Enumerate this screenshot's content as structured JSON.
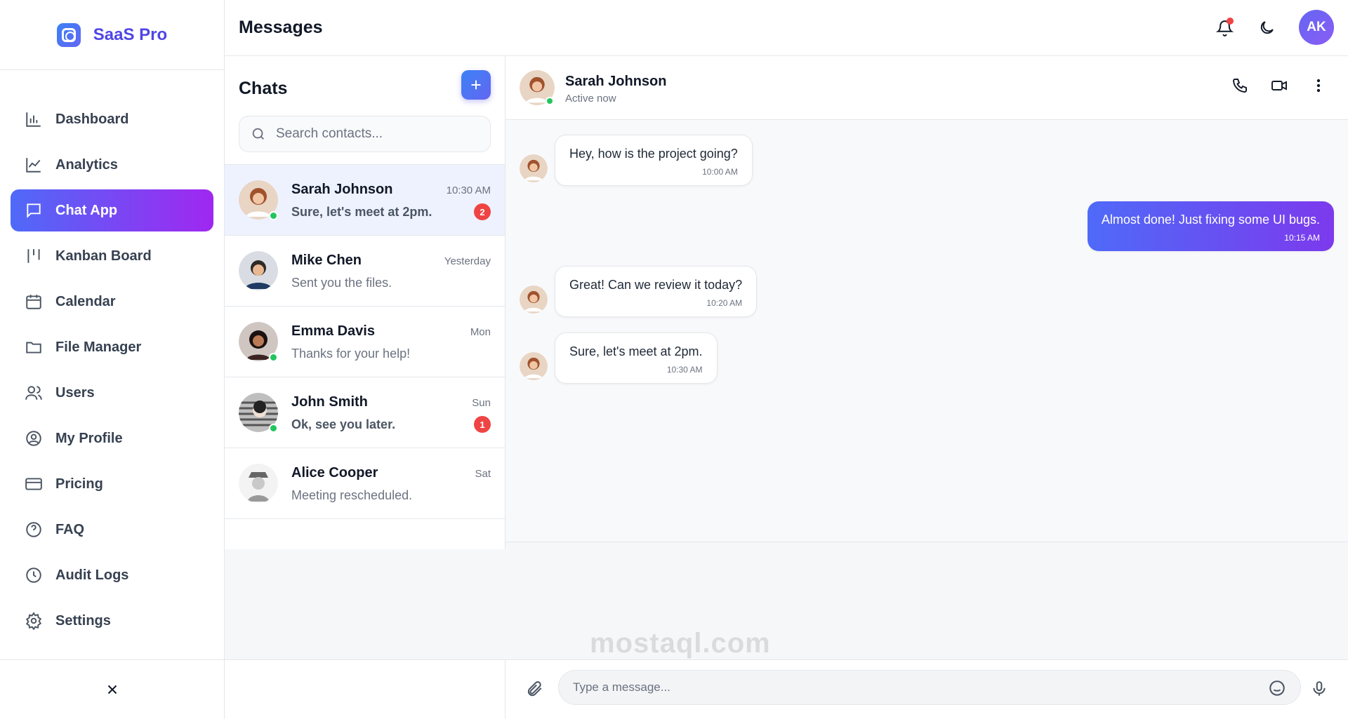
{
  "app": {
    "name": "SaaS Pro"
  },
  "sidebar": {
    "items": [
      {
        "label": "Dashboard",
        "icon": "bar-chart-icon"
      },
      {
        "label": "Analytics",
        "icon": "line-chart-icon"
      },
      {
        "label": "Chat App",
        "icon": "chat-icon",
        "active": true
      },
      {
        "label": "Kanban Board",
        "icon": "kanban-icon"
      },
      {
        "label": "Calendar",
        "icon": "calendar-icon"
      },
      {
        "label": "File Manager",
        "icon": "folder-icon"
      },
      {
        "label": "Users",
        "icon": "users-icon"
      },
      {
        "label": "My Profile",
        "icon": "user-circle-icon"
      },
      {
        "label": "Pricing",
        "icon": "credit-card-icon"
      },
      {
        "label": "FAQ",
        "icon": "help-circle-icon"
      },
      {
        "label": "Audit Logs",
        "icon": "clock-icon"
      },
      {
        "label": "Settings",
        "icon": "gear-icon"
      }
    ]
  },
  "header": {
    "title": "Messages",
    "avatar_initials": "AK"
  },
  "chats": {
    "title": "Chats",
    "search_placeholder": "Search contacts...",
    "list": [
      {
        "name": "Sarah Johnson",
        "time": "10:30 AM",
        "last": "Sure, let's meet at 2pm.",
        "unread": "2",
        "online": true
      },
      {
        "name": "Mike Chen",
        "time": "Yesterday",
        "last": "Sent you the files.",
        "unread": "",
        "online": false
      },
      {
        "name": "Emma Davis",
        "time": "Mon",
        "last": "Thanks for your help!",
        "unread": "",
        "online": true
      },
      {
        "name": "John Smith",
        "time": "Sun",
        "last": "Ok, see you later.",
        "unread": "1",
        "online": true
      },
      {
        "name": "Alice Cooper",
        "time": "Sat",
        "last": "Meeting rescheduled.",
        "unread": "",
        "online": false
      }
    ]
  },
  "conversation": {
    "contact_name": "Sarah Johnson",
    "contact_status": "Active now",
    "messages": [
      {
        "text": "Hey, how is the project going?",
        "time": "10:00 AM",
        "from": "them"
      },
      {
        "text": "Almost done! Just fixing some UI bugs.",
        "time": "10:15 AM",
        "from": "me"
      },
      {
        "text": "Great! Can we review it today?",
        "time": "10:20 AM",
        "from": "them"
      },
      {
        "text": "Sure, let's meet at 2pm.",
        "time": "10:30 AM",
        "from": "them"
      }
    ]
  },
  "composer": {
    "placeholder": "Type a message..."
  },
  "watermark": "mostaql.com",
  "colors": {
    "accent": "#4f6af8",
    "accent_end": "#a027f0",
    "online": "#22c55e",
    "badge": "#ef4444"
  }
}
